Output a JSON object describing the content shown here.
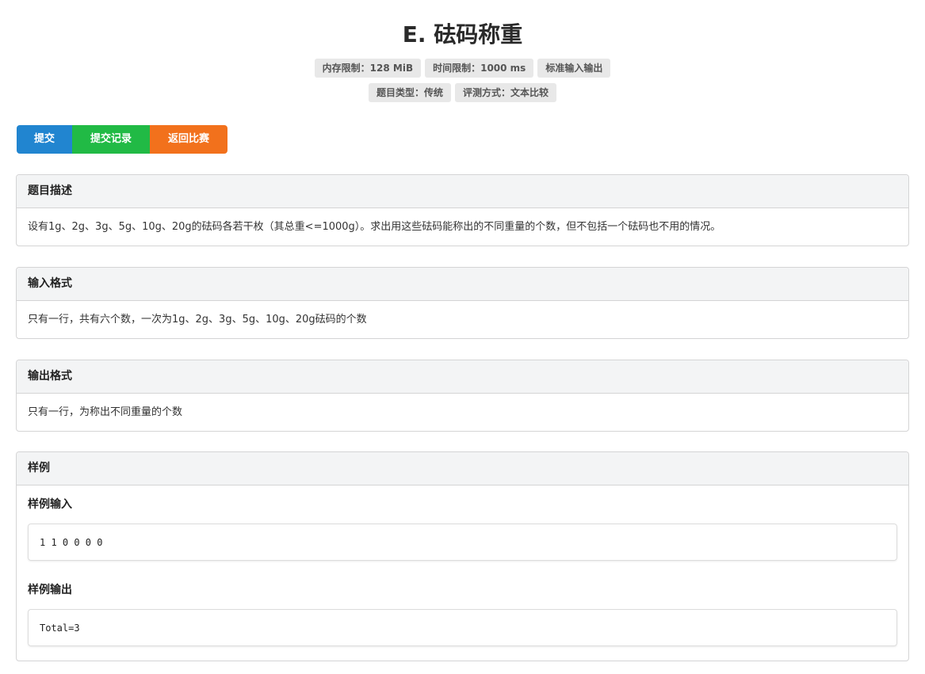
{
  "problem": {
    "title": "E. 砝码称重",
    "labels_row1": [
      "内存限制：128 MiB",
      "时间限制：1000 ms",
      "标准输入输出"
    ],
    "labels_row2": [
      "题目类型：传统",
      "评测方式：文本比较"
    ]
  },
  "actions": {
    "submit_label": "提交",
    "records_label": "提交记录",
    "back_label": "返回比赛",
    "colors": {
      "submit": "#2185d0",
      "records": "#21ba45",
      "back": "#f2711c"
    }
  },
  "sections": {
    "description": {
      "header": "题目描述",
      "body": "设有1g、2g、3g、5g、10g、20g的砝码各若干枚（其总重<=1000g）。求出用这些砝码能称出的不同重量的个数，但不包括一个砝码也不用的情况。"
    },
    "input_format": {
      "header": "输入格式",
      "body": "只有一行，共有六个数，一次为1g、2g、3g、5g、10g、20g砝码的个数"
    },
    "output_format": {
      "header": "输出格式",
      "body": "只有一行，为称出不同重量的个数"
    },
    "samples": {
      "header": "样例",
      "input_label": "样例输入",
      "input_value": "1 1 0 0 0 0",
      "output_label": "样例输出",
      "output_value": "Total=3"
    }
  }
}
